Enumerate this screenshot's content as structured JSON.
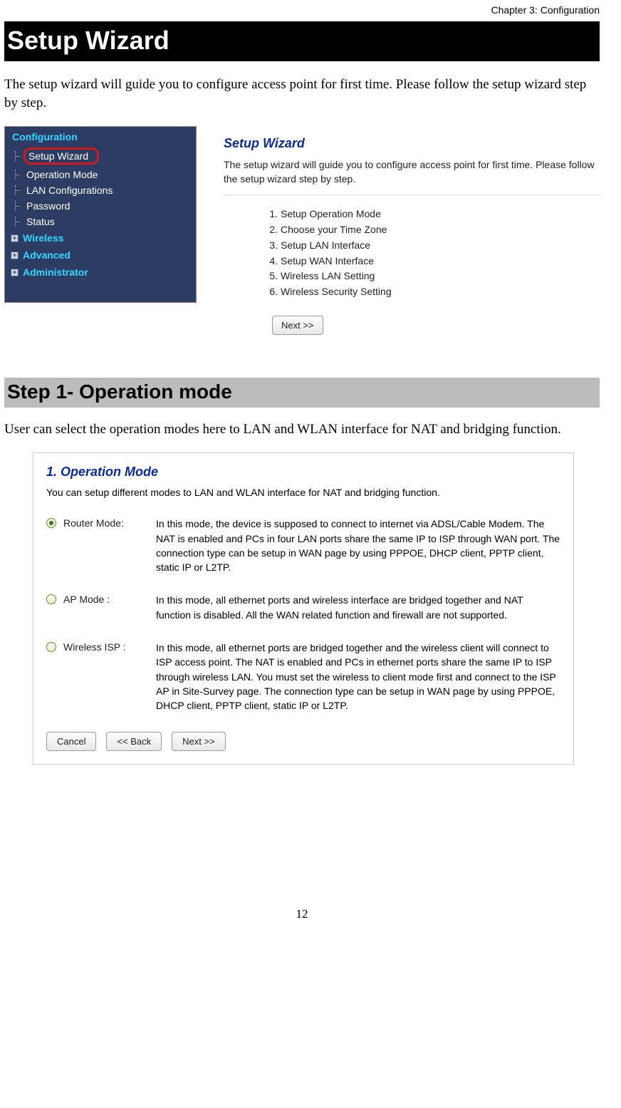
{
  "chapter": "Chapter 3: Configuration",
  "h1": "Setup Wizard",
  "intro": "The setup wizard will guide you to configure access point for first time. Please follow the setup wizard step by step.",
  "sidenav": {
    "group_config": "Configuration",
    "items": {
      "setup_wizard": "Setup Wizard",
      "operation_mode": "Operation Mode",
      "lan_config": "LAN Configurations",
      "password": "Password",
      "status": "Status"
    },
    "group_wireless": "Wireless",
    "group_advanced": "Advanced",
    "group_admin": "Administrator"
  },
  "rp": {
    "title": "Setup Wizard",
    "desc": "The setup wizard will guide you to configure access point for first time. Please follow the setup wizard step by step.",
    "steps": {
      "1": "Setup Operation Mode",
      "2": "Choose your Time Zone",
      "3": "Setup LAN Interface",
      "4": "Setup WAN Interface",
      "5": "Wireless LAN Setting",
      "6": "Wireless Security Setting"
    },
    "next": "Next >>"
  },
  "h2": "Step 1- Operation mode",
  "step1_intro": "User can select the operation modes here to LAN and WLAN interface for NAT and bridging function.",
  "s2": {
    "title": "1. Operation Mode",
    "desc": "You can setup different modes to LAN and WLAN interface for NAT and bridging function.",
    "modes": {
      "router": {
        "label": "Router Mode:",
        "desc": "In this mode, the device is supposed to connect to internet via ADSL/Cable Modem. The NAT is enabled and PCs in four LAN ports share the same IP to ISP through WAN port. The connection type can be setup in WAN page by using PPPOE, DHCP client, PPTP client, static IP or L2TP."
      },
      "ap": {
        "label": "AP Mode :",
        "desc": "In this mode, all ethernet ports and wireless interface are bridged together and NAT function is disabled. All the WAN related function and firewall are not supported."
      },
      "wisp": {
        "label": "Wireless ISP :",
        "desc": "In this mode, all ethernet ports are bridged together and the wireless client will connect to ISP access point. The NAT is enabled and PCs in ethernet ports share the same IP to ISP through wireless LAN. You must set the wireless to client mode first and connect to the ISP AP in Site-Survey page. The connection type can be setup in WAN page by using PPPOE, DHCP client, PPTP client, static IP or L2TP."
      }
    },
    "buttons": {
      "cancel": "Cancel",
      "back": "<< Back",
      "next": "Next >>"
    }
  },
  "page_number": "12"
}
